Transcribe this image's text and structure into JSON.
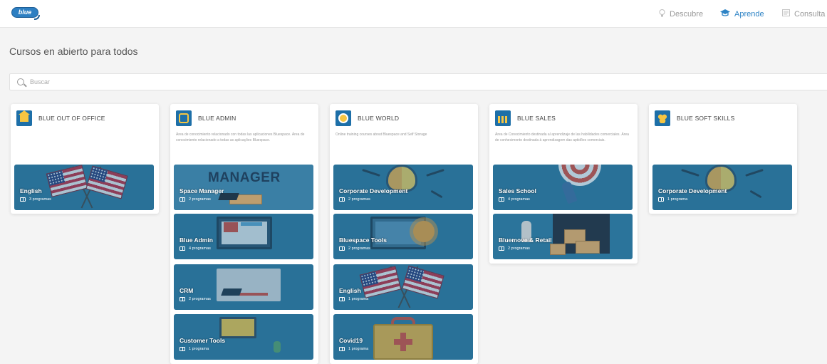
{
  "app": {
    "logo_text": "blue"
  },
  "nav": [
    {
      "label": "Descubre",
      "icon": "lightbulb-icon",
      "active": false
    },
    {
      "label": "Aprende",
      "icon": "graduation-cap-icon",
      "active": true
    },
    {
      "label": "Consulta",
      "icon": "document-icon",
      "active": false
    }
  ],
  "page": {
    "title": "Cursos en abierto para todos"
  },
  "search": {
    "placeholder": "Buscar"
  },
  "colors": {
    "accent": "#2d83c5",
    "card_bg": "#2f789f",
    "icon_bg": "#1d6fa8"
  },
  "areas": [
    {
      "title": "BLUE OUT OF OFFICE",
      "icon": "house-icon",
      "description": "",
      "courses": [
        {
          "name": "English",
          "programs": "3 programas"
        }
      ]
    },
    {
      "title": "BLUE ADMIN",
      "icon": "admin-icon",
      "description": "Área de conocimiento relacionado con todas las aplicaciones Bluespace. Área de conocimiento relacionado a todas as aplicações Bluespace.",
      "courses": [
        {
          "name": "Space Manager",
          "programs": "2 programas",
          "banner": "MANAGER"
        },
        {
          "name": "Blue Admin",
          "programs": "4 programas"
        },
        {
          "name": "CRM",
          "programs": "2 programas"
        },
        {
          "name": "Customer Tools",
          "programs": "1 programa"
        }
      ]
    },
    {
      "title": "BLUE WORLD",
      "icon": "globe-icon",
      "description": "Online training courses about Bluespace and Self Storage",
      "courses": [
        {
          "name": "Corporate Development",
          "programs": "2 programas"
        },
        {
          "name": "Bluespace Tools",
          "programs": "2 programas"
        },
        {
          "name": "English",
          "programs": "1 programa"
        },
        {
          "name": "Covid19",
          "programs": "1 programa"
        }
      ]
    },
    {
      "title": "BLUE SALES",
      "icon": "sales-icon",
      "description": "Área de Conocimiento destinada al aprendizaje de las habilidades comerciales. Área de conhecimento destinada à aprendizagem das aptidões comerciais.",
      "courses": [
        {
          "name": "Sales School",
          "programs": "4 programas"
        },
        {
          "name": "Bluemove & Retail",
          "programs": "2 programas"
        }
      ]
    },
    {
      "title": "BLUE SOFT SKILLS",
      "icon": "people-icon",
      "description": "",
      "courses": [
        {
          "name": "Corporate Development",
          "programs": "1 programa"
        }
      ]
    }
  ]
}
